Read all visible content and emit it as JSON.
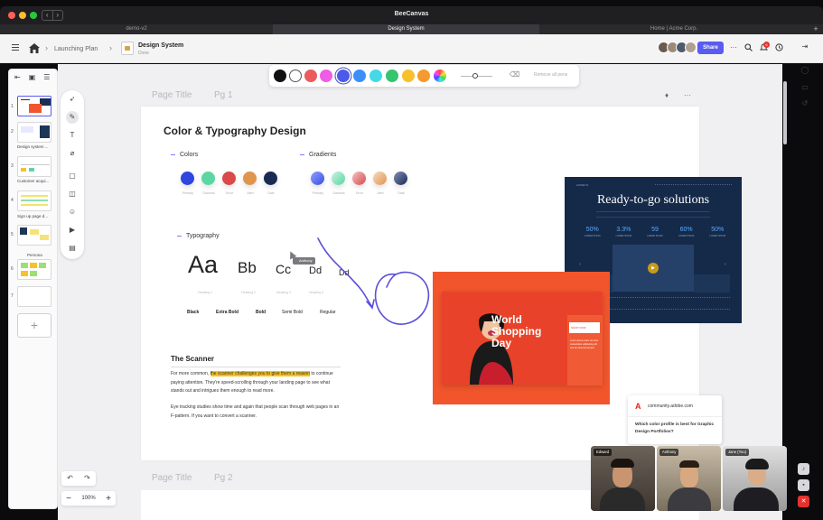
{
  "window": {
    "title": "BeeCanvas",
    "nav_back": "‹",
    "nav_forward": "›"
  },
  "tabs": [
    {
      "label": "demo-v2"
    },
    {
      "label": "Design System"
    },
    {
      "label": "Home | Acme Corp."
    }
  ],
  "tab_add": "+",
  "header": {
    "breadcrumb_1": "Launching Plan",
    "breadcrumb_sep": "›",
    "doc_title": "Design System",
    "doc_subtitle": "Done",
    "share_label": "Share",
    "more": "···",
    "notification_count": "6"
  },
  "slides": [
    {
      "num": "1",
      "label": ""
    },
    {
      "num": "2",
      "label": "Design system ..."
    },
    {
      "num": "3",
      "label": "Customer acqui..."
    },
    {
      "num": "4",
      "label": "Sign up page d..."
    },
    {
      "num": "5",
      "label": "Persona"
    },
    {
      "num": "6",
      "label": ""
    },
    {
      "num": "7",
      "label": ""
    }
  ],
  "slide_add": "+",
  "canvas": {
    "page1_label": "Page Title",
    "page1_num": "Pg 1",
    "page2_label": "Page Title",
    "page2_num": "Pg 2"
  },
  "color_bar": {
    "swatches": [
      "#111111",
      "#ffffff",
      "#ec5b5b",
      "#f05be8",
      "#4a5be8",
      "#3d8ef7",
      "#45d8e6",
      "#35c56f",
      "#f6c12d",
      "#f59a2f",
      "rainbow"
    ],
    "remove_all": "Remove all pens"
  },
  "design": {
    "title": "Color & Typography Design",
    "colors_label": "Colors",
    "gradients_label": "Gradients",
    "typography_label": "Typography",
    "color_dots": [
      {
        "hex": "#2f45e0",
        "name": "Primary"
      },
      {
        "hex": "#5cd6a3",
        "name": "Success"
      },
      {
        "hex": "#d94a4a",
        "name": "Error"
      },
      {
        "hex": "#e0944e",
        "name": "Alert"
      },
      {
        "hex": "#1a2a52",
        "name": "Dark"
      }
    ],
    "gradient_dots": [
      {
        "from": "#8ea0ff",
        "to": "#3b4fe0",
        "name": "Primary"
      },
      {
        "from": "#c8f2e0",
        "to": "#5cd6a3",
        "name": "Success"
      },
      {
        "from": "#f3c4c4",
        "to": "#d94a4a",
        "name": "Error"
      },
      {
        "from": "#f6dcc0",
        "to": "#e0944e",
        "name": "Alert"
      },
      {
        "from": "#8090b8",
        "to": "#1a2a52",
        "name": "Dark"
      }
    ],
    "type_samples": [
      {
        "text": "Aa",
        "label": "Heading 1"
      },
      {
        "text": "Bb",
        "label": "Heading 2"
      },
      {
        "text": "Cc",
        "label": "Heading 3"
      },
      {
        "text": "Dd",
        "label": "Heading 4"
      },
      {
        "text": "Dd",
        "label": ""
      }
    ],
    "weights": [
      "Black",
      "Extra Bold",
      "Bold",
      "Semi Bold",
      "Regular"
    ]
  },
  "scanner": {
    "title": "The Scanner",
    "p1_pre": "For more common, ",
    "p1_highlight": "the scanner challenges you to give them a reason",
    "p1_post": " to continue paying attention. They're speed-scrolling through your landing page to see what stands out and intrigues them enough to read more.",
    "p2": "Eye tracking studies show time and again that people scan through web pages in an F-pattern. If you want to convert a scanner."
  },
  "ready_card": {
    "brand": "ACMECO",
    "heading": "Ready-to-go solutions",
    "stats": [
      {
        "value": "50%",
        "label": "LOREM IPSUM"
      },
      {
        "value": "3.3%",
        "label": "LOREM IPSUM"
      },
      {
        "value": "59",
        "label": "LOREM IPSUM"
      },
      {
        "value": "60%",
        "label": "LOREM IPSUM"
      },
      {
        "value": "50%",
        "label": "LOREM IPSUM"
      }
    ],
    "play": "▶",
    "arrow_left": "‹",
    "arrow_right": "›"
  },
  "shop_card": {
    "headline_1": "World",
    "headline_2": "Shopping",
    "headline_3": "Day",
    "panel_btn": "SHOP NOW",
    "panel_text": "Lorem ipsum dolor sit amet consectetur adipiscing elit sed do eiusmod tempor"
  },
  "adobe_card": {
    "logo": "A",
    "url": "community.adobe.com",
    "question": "Which color profile is best for Graphic Design Portfolios?"
  },
  "cursor_label": "Anthony",
  "controls": {
    "undo": "↶",
    "redo": "↷",
    "zoom_out": "−",
    "zoom": "100%",
    "zoom_in": "+"
  },
  "participants": [
    {
      "name": "Edward"
    },
    {
      "name": "Anthony"
    },
    {
      "name": "Jane (You)"
    }
  ],
  "accent_color": "#5b5bf0"
}
